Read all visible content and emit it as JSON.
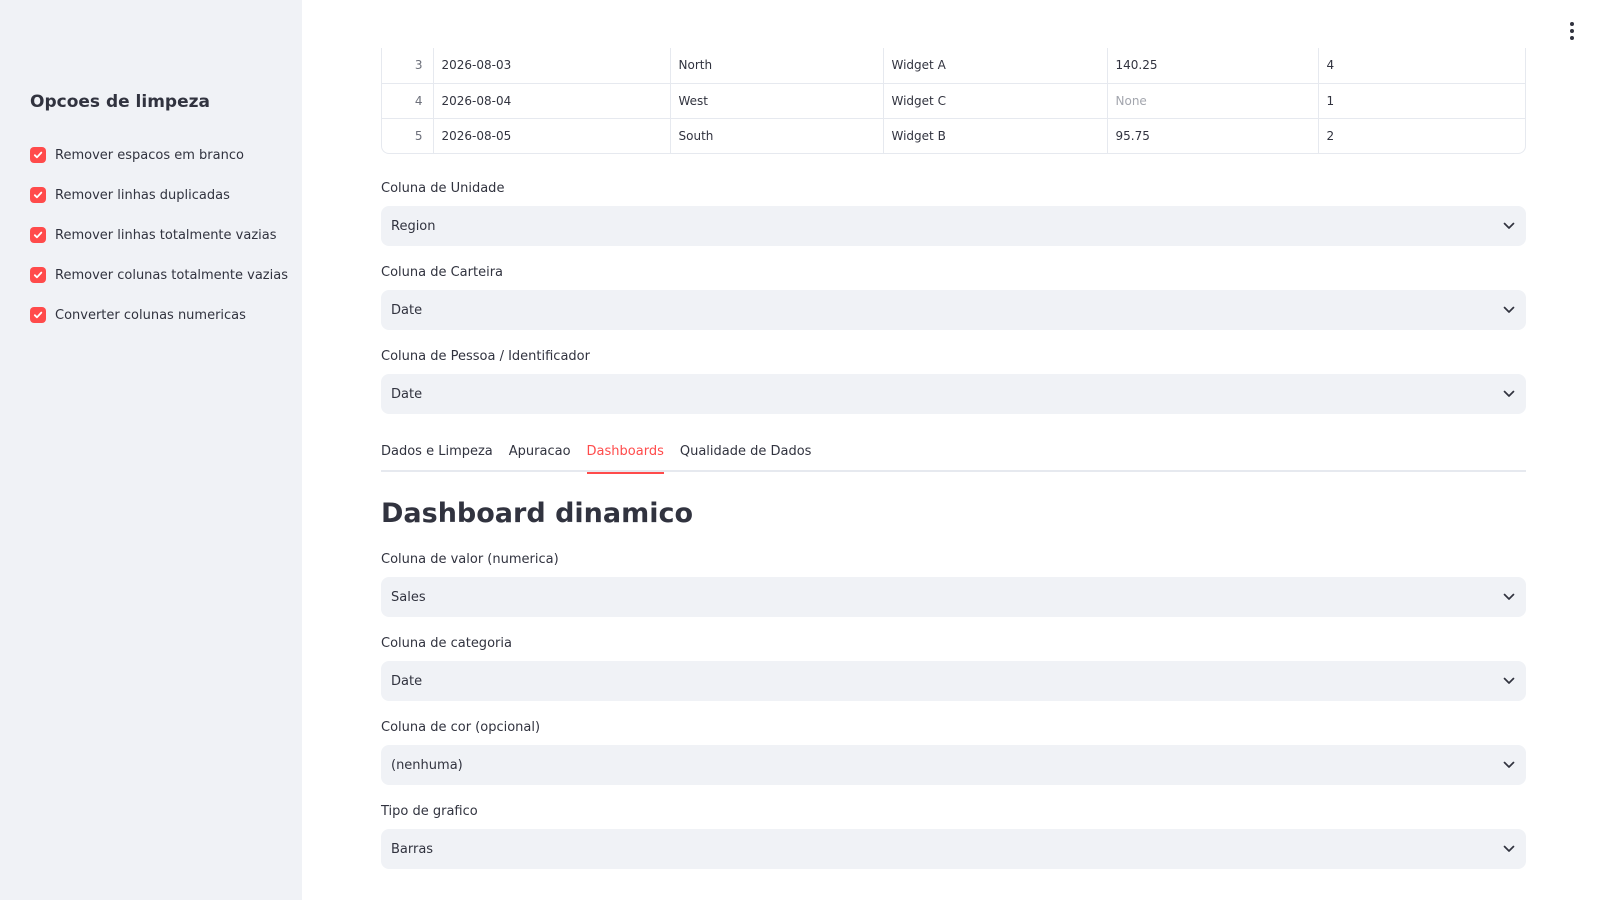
{
  "sidebar": {
    "title": "Opcoes de limpeza",
    "options": [
      {
        "label": "Remover espacos em branco",
        "checked": true
      },
      {
        "label": "Remover linhas duplicadas",
        "checked": true
      },
      {
        "label": "Remover linhas totalmente vazias",
        "checked": true
      },
      {
        "label": "Remover colunas totalmente vazias",
        "checked": true
      },
      {
        "label": "Converter colunas numericas",
        "checked": true
      }
    ]
  },
  "table": {
    "rows": [
      [
        "3",
        "2026-08-03",
        "North",
        "Widget A",
        "140.25",
        "4"
      ],
      [
        "4",
        "2026-08-04",
        "West",
        "Widget C",
        "None",
        "1"
      ],
      [
        "5",
        "2026-08-05",
        "South",
        "Widget B",
        "95.75",
        "2"
      ]
    ]
  },
  "upper_fields": {
    "unidade": {
      "label": "Coluna de Unidade",
      "value": "Region"
    },
    "carteira": {
      "label": "Coluna de Carteira",
      "value": "Date"
    },
    "pessoa": {
      "label": "Coluna de Pessoa / Identificador",
      "value": "Date"
    }
  },
  "tabs": [
    {
      "label": "Dados e Limpeza",
      "active": false
    },
    {
      "label": "Apuracao",
      "active": false
    },
    {
      "label": "Dashboards",
      "active": true
    },
    {
      "label": "Qualidade de Dados",
      "active": false
    }
  ],
  "dashboard": {
    "title": "Dashboard dinamico",
    "valor": {
      "label": "Coluna de valor (numerica)",
      "value": "Sales"
    },
    "categoria": {
      "label": "Coluna de categoria",
      "value": "Date"
    },
    "cor": {
      "label": "Coluna de cor (opcional)",
      "value": "(nenhuma)"
    },
    "grafico": {
      "label": "Tipo de grafico",
      "value": "Barras"
    }
  },
  "colors": {
    "accent": "#ff4b4b",
    "sidebar_bg": "#f0f2f6",
    "text": "#31333f"
  },
  "icons": {
    "checkbox": "check-icon",
    "select": "chevron-down-icon",
    "menu": "kebab-menu-icon"
  }
}
